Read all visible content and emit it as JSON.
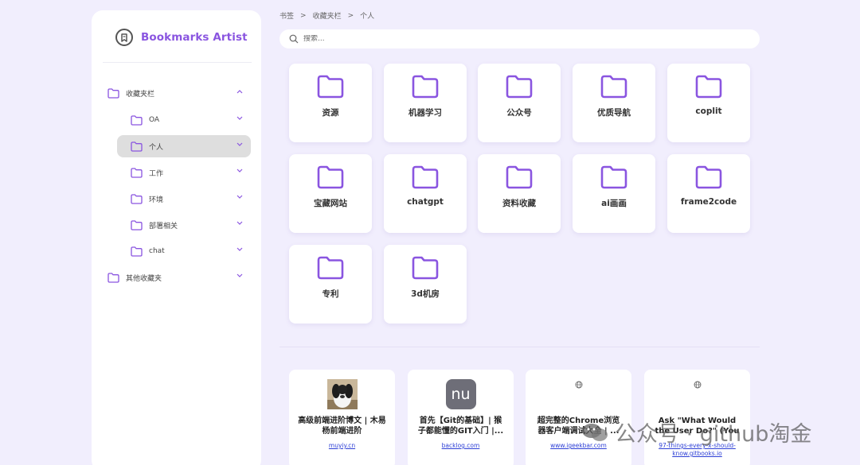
{
  "app": {
    "name": "Bookmarks Artist",
    "logo_icon": "bookmark-icon"
  },
  "colors": {
    "accent": "#8a55e0",
    "background": "#f1eefd",
    "selected_row": "#dedede",
    "link": "#2d3fd6"
  },
  "breadcrumb": [
    "书签",
    "收藏夹栏",
    "个人"
  ],
  "breadcrumb_separator": ">",
  "search": {
    "placeholder": "搜索...",
    "value": ""
  },
  "sidebar": {
    "tree": [
      {
        "label": "收藏夹栏",
        "expanded": true
      },
      {
        "label": "OA"
      },
      {
        "label": "个人",
        "selected": true
      },
      {
        "label": "工作"
      },
      {
        "label": "环境"
      },
      {
        "label": "部署相关"
      },
      {
        "label": "chat"
      },
      {
        "label": "其他收藏夹"
      }
    ]
  },
  "folders": [
    "资源",
    "机器学习",
    "公众号",
    "优质导航",
    "coplit",
    "宝藏网站",
    "chatgpt",
    "资料收藏",
    "ai画画",
    "frame2code",
    "专利",
    "3d机房"
  ],
  "bookmarks": [
    {
      "title": "高级前端进阶博文 | 木易杨前端进阶",
      "url": "muyiy.cn",
      "thumb": "dog-photo"
    },
    {
      "title": "首先【Git的基础】| 猴子都能懂的GIT入门 |...",
      "url": "backlog.com",
      "thumb": "nu-logo",
      "thumb_text": "nu"
    },
    {
      "title": "超完整的Chrome浏览器客户端调试大全 | ...",
      "url": "www.igeekbar.com",
      "thumb": "globe-icon"
    },
    {
      "title": "Ask \"What Would the User Do?\" (You Are...",
      "url": "97-things-every-x-should-know.gitbooks.io",
      "thumb": "globe-icon"
    }
  ],
  "watermark": {
    "text": "公众号 · github淘金"
  }
}
